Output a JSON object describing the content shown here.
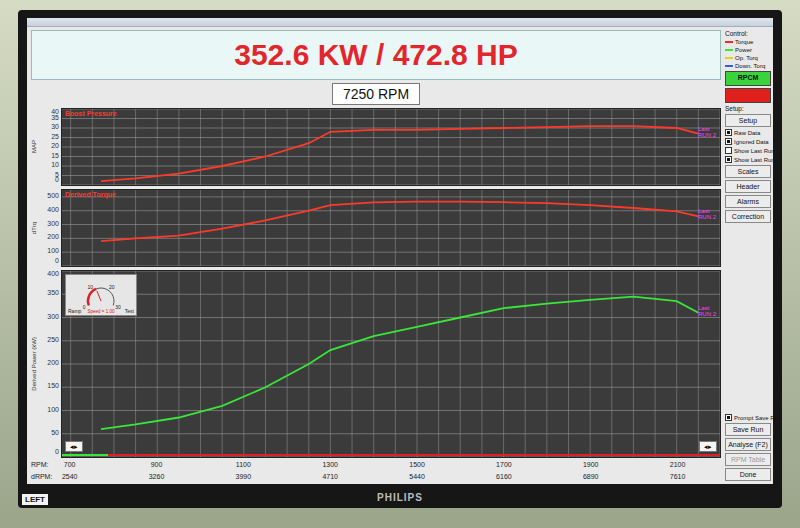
{
  "monitor": {
    "brand": "PHILIPS",
    "sticker": "LEFT"
  },
  "header": {
    "reading": "352.6 KW / 472.8 HP",
    "rpm": "7250 RPM"
  },
  "rpm": [
    770,
    850,
    950,
    1050,
    1150,
    1250,
    1300,
    1400,
    1500,
    1600,
    1700,
    1800,
    1900,
    2000,
    2100,
    2150
  ],
  "charts": [
    {
      "title": "Boost Pressure",
      "axis_label": "MAP",
      "max": 40,
      "ticks": [
        "40",
        "35",
        "30",
        "25",
        "20",
        "15",
        "10",
        "5",
        "0"
      ],
      "tag": [
        "Last",
        "RUN 2"
      ],
      "color": "#ff3a2a",
      "values": [
        2,
        3.5,
        6,
        10,
        15,
        22,
        28,
        29,
        29,
        29.5,
        30,
        30.5,
        31,
        31,
        30,
        27
      ]
    },
    {
      "title": "Derived Torque",
      "axis_label": "dTrq",
      "max": 550,
      "ticks": [
        "500",
        "400",
        "300",
        "200",
        "100",
        "0"
      ],
      "tag": [
        "Last",
        "RUN 2"
      ],
      "color": "#ff3a2a",
      "values": [
        180,
        200,
        220,
        270,
        330,
        400,
        440,
        460,
        465,
        465,
        462,
        455,
        440,
        420,
        395,
        360
      ]
    },
    {
      "axis_label": "Derived Power (kW)",
      "max": 400,
      "ticks": [
        "400",
        "350",
        "300",
        "250",
        "200",
        "150",
        "100",
        "50",
        "0"
      ],
      "tag": [
        "Last",
        "RUN 2"
      ],
      "color": "#39e639",
      "values": [
        60,
        70,
        85,
        110,
        150,
        200,
        230,
        260,
        280,
        300,
        320,
        330,
        338,
        345,
        335,
        310
      ]
    }
  ],
  "x_axis": [
    {
      "label": "RPM:",
      "ticks": [
        "700",
        "900",
        "1100",
        "1300",
        "1500",
        "1700",
        "1900",
        "2100"
      ]
    },
    {
      "label": "dRPM:",
      "ticks": [
        "2540",
        "3260",
        "3990",
        "4710",
        "5440",
        "6160",
        "6890",
        "7610"
      ]
    }
  ],
  "gauge": {
    "ticks": [
      "0",
      "10",
      "20",
      "30"
    ],
    "labels": [
      "Ramp",
      "Test"
    ],
    "caption": "Speed = 1.00",
    "level": 0.4
  },
  "progress": {
    "level": 0.07
  },
  "scroll_buttons": [
    "◂▸",
    "◂▸"
  ],
  "sidebar": {
    "control": {
      "label": "Control:",
      "legend": [
        {
          "label": "Torque",
          "color": "#e8302a"
        },
        {
          "label": "Power",
          "color": "#39e639"
        },
        {
          "label": "Op. Torq",
          "color": "#d8d820"
        },
        {
          "label": "Down. Torq",
          "color": "#3060e0"
        }
      ]
    },
    "mode_buttons": [
      {
        "label": "RPCM",
        "color": "#3ad43a"
      },
      {
        "label": "",
        "color": "#e0201c"
      }
    ],
    "setup": {
      "label": "Setup:",
      "button": "Setup",
      "options": [
        {
          "label": "Raw Data",
          "checked": true
        },
        {
          "label": "Ignored Data",
          "checked": true
        },
        {
          "label": "Show Last Run",
          "checked": false
        },
        {
          "label": "Show Last Run",
          "checked": true
        }
      ]
    },
    "tools": [
      "Scales",
      "Header",
      "Alarms",
      "Correction"
    ],
    "prompt": {
      "label": "Prompt Save Run",
      "checked": true
    },
    "actions": [
      {
        "label": "Save Run",
        "disabled": false
      },
      {
        "label": "Analyse (F2)",
        "disabled": false
      },
      {
        "label": "RPM Table",
        "disabled": true
      },
      {
        "label": "Done",
        "disabled": false
      }
    ]
  }
}
